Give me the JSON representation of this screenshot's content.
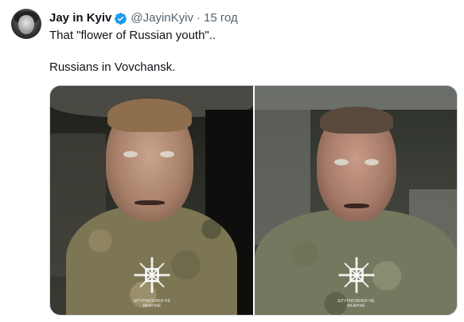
{
  "author": {
    "display_name": "Jay in Kyiv",
    "handle": "@JayinKyiv",
    "separator": "·",
    "timestamp": "15 год"
  },
  "tweet": {
    "line1": "That \"flower of Russian youth\"..",
    "line2": "Russians in Vovchansk."
  },
  "media": {
    "count": 2,
    "watermark_caption": "ШТУРМОВИКИ НЕ ВАЖНИЕ"
  },
  "colors": {
    "verified_badge": "#1d9bf0",
    "secondary_text": "#536471",
    "primary_text": "#0f1419",
    "media_border": "#cfd9de"
  },
  "icons": {
    "verified": "verified-badge-icon",
    "watermark": "cross-emblem-icon"
  }
}
